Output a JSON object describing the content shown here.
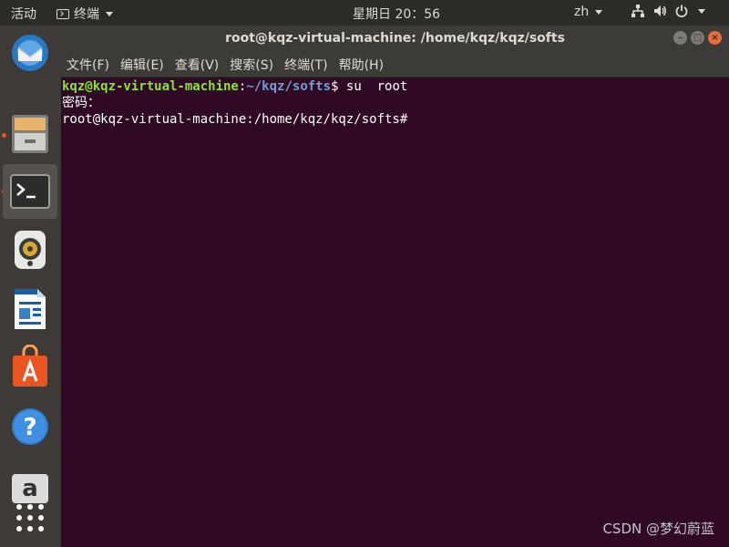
{
  "top_panel": {
    "activities": "活动",
    "app_menu": "终端",
    "clock": "星期日 20：56",
    "language": "zh"
  },
  "dock": {
    "items": [
      {
        "name": "thunderbird",
        "icon": "thunderbird-mail-icon",
        "running": false
      },
      {
        "name": "files",
        "icon": "file-cabinet-icon",
        "running": true
      },
      {
        "name": "terminal",
        "icon": "terminal-icon",
        "running": true,
        "active": true
      },
      {
        "name": "rhythmbox",
        "icon": "speaker-icon",
        "running": false
      },
      {
        "name": "libreoffice-writer",
        "icon": "writer-document-icon",
        "running": false
      },
      {
        "name": "ubuntu-software",
        "icon": "shopping-bag-icon",
        "running": false
      },
      {
        "name": "help",
        "icon": "question-mark-icon",
        "running": false
      },
      {
        "name": "amazon",
        "icon": "amazon-icon",
        "running": false
      },
      {
        "name": "show-applications",
        "icon": "app-grid-icon",
        "running": false
      }
    ]
  },
  "window": {
    "title": "root@kqz-virtual-machine: /home/kqz/kqz/softs",
    "menu": [
      "文件(F)",
      "编辑(E)",
      "查看(V)",
      "搜索(S)",
      "终端(T)",
      "帮助(H)"
    ]
  },
  "terminal": {
    "line1_user": "kqz@kqz-virtual-machine",
    "line1_sep": ":",
    "line1_path": "~/kqz/softs",
    "line1_cmd": "$ su  root",
    "line2": "密码：",
    "line3": "root@kqz-virtual-machine:/home/kqz/kqz/softs#"
  },
  "watermark": "CSDN @梦幻蔚蓝",
  "colors": {
    "terminal_bg": "#300a24",
    "prompt_user": "#8ae234",
    "prompt_path": "#729fcf",
    "accent": "#e95420"
  }
}
